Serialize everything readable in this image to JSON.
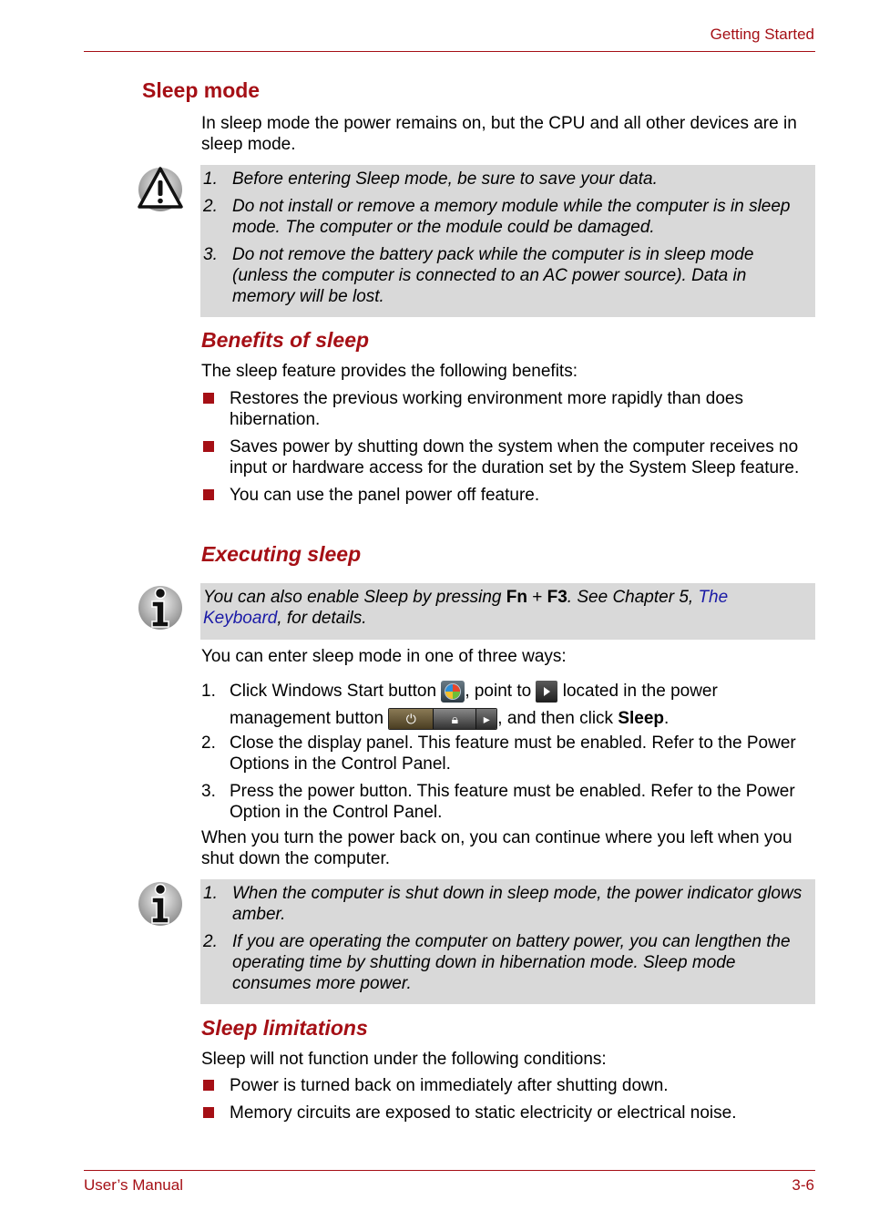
{
  "header": {
    "section": "Getting Started"
  },
  "footer": {
    "manual": "User’s Manual",
    "page": "3-6"
  },
  "title": "Sleep mode",
  "intro": "In sleep mode the power remains on, but the CPU and all other devices are in sleep mode.",
  "caution_note": {
    "icon": "warning-icon",
    "items": [
      {
        "num": "1.",
        "text": "Before entering Sleep mode, be sure to save your data."
      },
      {
        "num": "2.",
        "text": "Do not install or remove a memory module while the computer is in sleep mode. The computer or the module could be damaged."
      },
      {
        "num": "3.",
        "text": "Do not remove the battery pack while the computer is in sleep mode (unless the computer is connected to an AC power source). Data in memory will be lost."
      }
    ]
  },
  "benefits": {
    "heading": "Benefits of sleep",
    "intro": "The sleep feature provides the following benefits:",
    "items": [
      "Restores the previous working environment more rapidly than does hibernation.",
      "Saves power by shutting down the system when the computer receives no input or hardware access for the duration set by the System Sleep feature.",
      "You can use the panel power off feature."
    ]
  },
  "executing": {
    "heading": "Executing sleep",
    "info_note": {
      "icon": "info-icon",
      "prefix": "You can also enable Sleep by pressing ",
      "key1": "Fn",
      "plus": " + ",
      "key2": "F3",
      "middle": ". See Chapter 5, ",
      "link": "The Keyboard",
      "suffix": ", for details."
    },
    "intro": "You can enter sleep mode in one of three ways:",
    "step1": {
      "num": "1.",
      "part1": "Click Windows Start button ",
      "part2": ", point to ",
      "part3": " located in the power management button ",
      "part4": ", and then click ",
      "bold": "Sleep",
      "end": ".",
      "icons": [
        "windows-start-icon",
        "arrow-right-icon",
        "power-management-button"
      ]
    },
    "steps": [
      {
        "num": "2.",
        "text": "Close the display panel. This feature must be enabled. Refer to the Power Options in the Control Panel."
      },
      {
        "num": "3.",
        "text": "Press the power button. This feature must be enabled. Refer to the Power Option in the Control Panel."
      }
    ],
    "after": "When you turn the power back on, you can continue where you left when you shut down the computer.",
    "info_note2": {
      "icon": "info-icon",
      "items": [
        {
          "num": "1.",
          "text": "When the computer is shut down in sleep mode, the power indicator glows amber."
        },
        {
          "num": "2.",
          "text": "If you are operating the computer on battery power, you can lengthen the operating time by shutting down in hibernation mode. Sleep mode consumes more power."
        }
      ]
    }
  },
  "limitations": {
    "heading": "Sleep limitations",
    "intro": "Sleep will not function under the following conditions:",
    "items": [
      "Power is turned back on immediately after shutting down.",
      "Memory circuits are exposed to static electricity or electrical noise."
    ]
  },
  "colors": {
    "accent": "#a50f15",
    "note_bg": "#d9d9d9",
    "link": "#1a1aa6"
  }
}
